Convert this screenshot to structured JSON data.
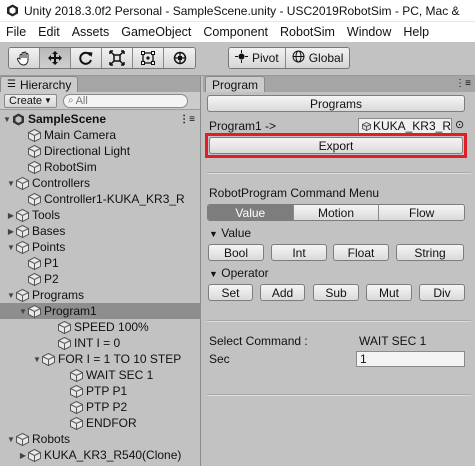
{
  "window": {
    "title": "Unity 2018.3.0f2 Personal - SampleScene.unity - USC2019RobotSim - PC, Mac &"
  },
  "menu": [
    "File",
    "Edit",
    "Assets",
    "GameObject",
    "Component",
    "RobotSim",
    "Window",
    "Help"
  ],
  "toolbar": {
    "tools": [
      "hand-tool-icon",
      "move-tool-icon",
      "rotate-tool-icon",
      "scale-tool-icon",
      "rect-tool-icon",
      "transform-tool-icon"
    ],
    "pivot_label": "Pivot",
    "global_label": "Global"
  },
  "hierarchy": {
    "tab": "Hierarchy",
    "create": "Create",
    "search_placeholder": "All",
    "scene": "SampleScene",
    "items": [
      {
        "label": "Main Camera"
      },
      {
        "label": "Directional Light"
      },
      {
        "label": "RobotSim"
      },
      {
        "label": "Controllers"
      },
      {
        "label": "Controller1-KUKA_KR3_R"
      },
      {
        "label": "Tools"
      },
      {
        "label": "Bases"
      },
      {
        "label": "Points"
      },
      {
        "label": "P1"
      },
      {
        "label": "P2"
      },
      {
        "label": "Programs"
      },
      {
        "label": "Program1"
      },
      {
        "label": "SPEED 100%"
      },
      {
        "label": "INT I = 0"
      },
      {
        "label": "FOR I = 1 TO 10 STEP"
      },
      {
        "label": "WAIT SEC 1"
      },
      {
        "label": "PTP P1"
      },
      {
        "label": "PTP P2"
      },
      {
        "label": "ENDFOR"
      },
      {
        "label": "Robots"
      },
      {
        "label": "KUKA_KR3_R540(Clone)"
      }
    ]
  },
  "program_panel": {
    "tab": "Program",
    "programs_button": "Programs",
    "program_label": "Program1 ->",
    "robot_field": "KUKA_KR3_R",
    "export_button": "Export",
    "command_menu_title": "RobotProgram Command Menu",
    "segments": [
      "Value",
      "Motion",
      "Flow"
    ],
    "selected_segment": "Value",
    "value_section": "Value",
    "value_buttons": [
      "Bool",
      "Int",
      "Float",
      "String"
    ],
    "operator_section": "Operator",
    "operator_buttons": [
      "Set",
      "Add",
      "Sub",
      "Mut",
      "Div"
    ],
    "select_command_label": "Select Command :",
    "select_command_value": "WAIT SEC 1",
    "sec_label": "Sec",
    "sec_value": "1",
    "highlight_color": "#e01e26"
  }
}
